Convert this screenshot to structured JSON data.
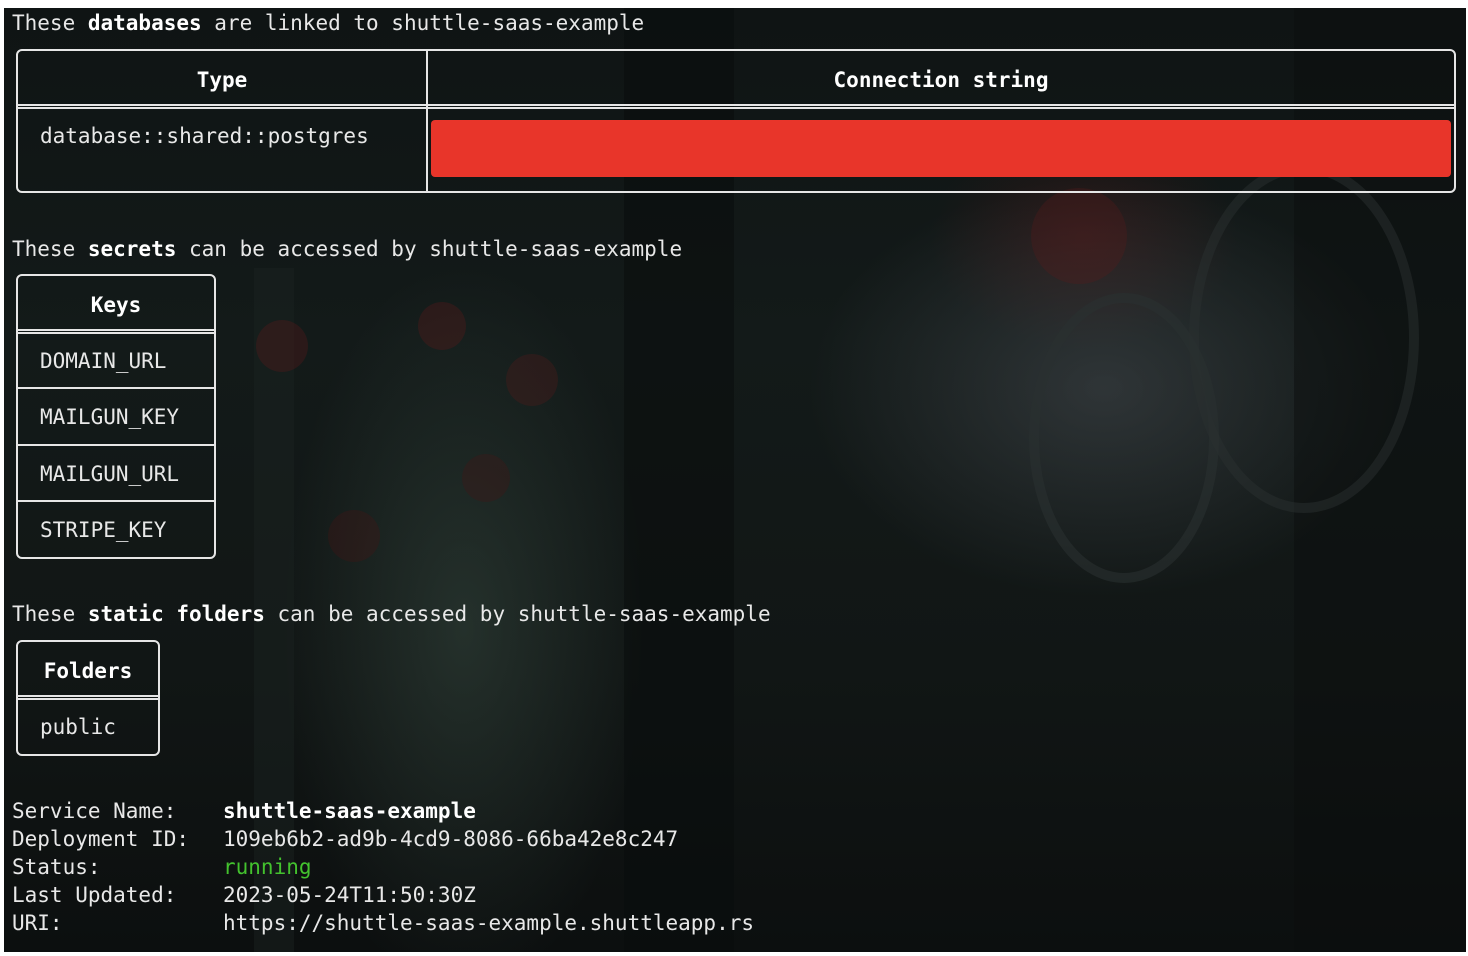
{
  "colors": {
    "terminal_bg": "#111615",
    "text": "#e8e8e8",
    "border": "#e6e6e6",
    "redaction": "#e8352a",
    "status_running": "#43c22e"
  },
  "databases": {
    "intro_prefix": "These ",
    "intro_bold": "databases",
    "intro_suffix": " are linked to shuttle-saas-example",
    "col_type": "Type",
    "col_conn": "Connection string",
    "rows": [
      {
        "type": "database::shared::postgres",
        "connection_string": ""
      }
    ]
  },
  "secrets": {
    "intro_prefix": "These ",
    "intro_bold": "secrets",
    "intro_suffix": " can be accessed by shuttle-saas-example",
    "col_keys": "Keys",
    "keys": [
      "DOMAIN_URL",
      "MAILGUN_KEY",
      "MAILGUN_URL",
      "STRIPE_KEY"
    ]
  },
  "folders": {
    "intro_prefix": "These ",
    "intro_bold": "static folders",
    "intro_suffix": " can be accessed by shuttle-saas-example",
    "col_folders": "Folders",
    "items": [
      "public"
    ]
  },
  "service": {
    "name_label": "Service Name:",
    "name_value": "shuttle-saas-example",
    "deployment_label": "Deployment ID:",
    "deployment_value": "109eb6b2-ad9b-4cd9-8086-66ba42e8c247",
    "status_label": "Status:",
    "status_value": "running",
    "updated_label": "Last Updated:",
    "updated_value": "2023-05-24T11:50:30Z",
    "uri_label": "URI:",
    "uri_value": "https://shuttle-saas-example.shuttleapp.rs"
  }
}
